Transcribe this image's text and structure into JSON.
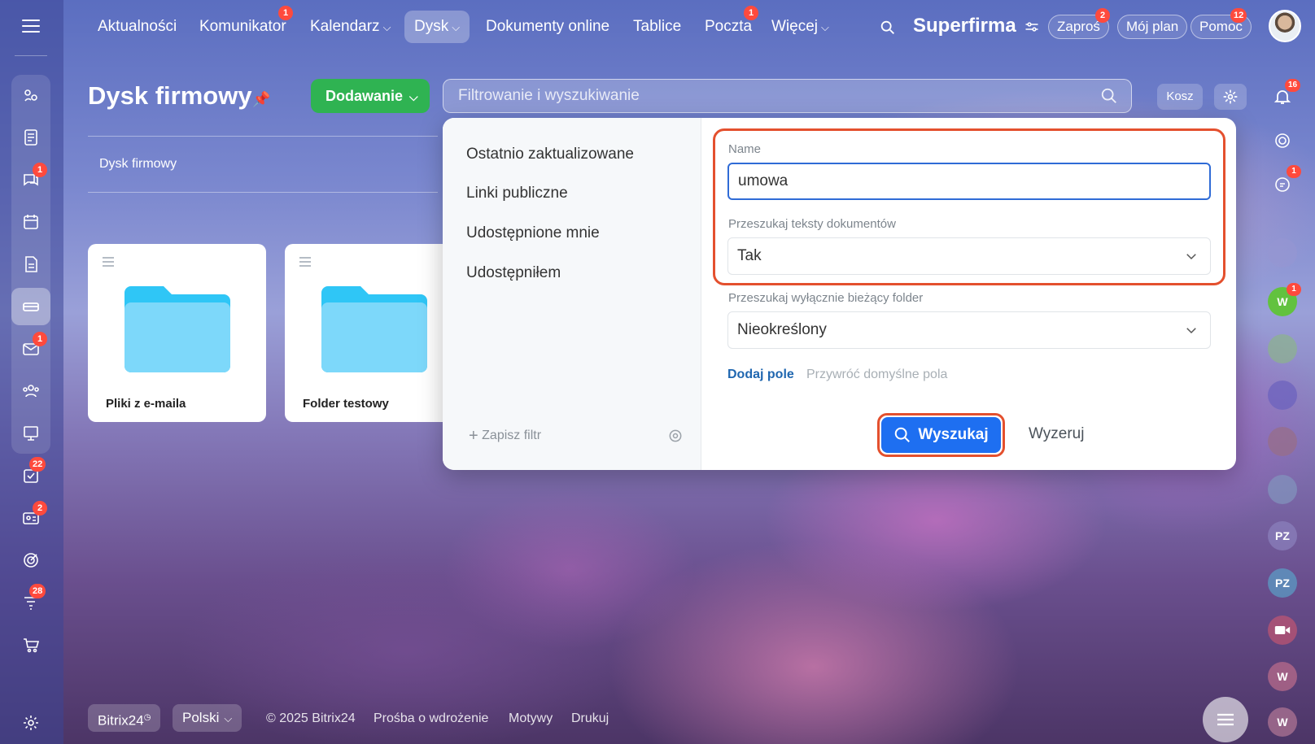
{
  "nav": {
    "items": [
      "Aktualności",
      "Komunikator",
      "Kalendarz",
      "Dysk",
      "Dokumenty online",
      "Tablice",
      "Poczta",
      "Więcej"
    ],
    "badges": {
      "komunikator": "1",
      "poczta": "1"
    },
    "brand": "Superfirma",
    "invite": "Zaproś",
    "invite_badge": "2",
    "my_plan": "Mój plan",
    "help": "Pomoc",
    "help_badge": "12"
  },
  "left_badges": {
    "chat": "1",
    "mail": "1",
    "tasks": "22",
    "crm": "2",
    "sites": "28"
  },
  "page": {
    "title": "Dysk firmowy",
    "add_button": "Dodawanie",
    "search_placeholder": "Filtrowanie i wyszukiwanie",
    "trash_button": "Kosz",
    "breadcrumb": "Dysk firmowy",
    "notifications_badge": "16"
  },
  "folders": [
    {
      "name": "Pliki z e-maila"
    },
    {
      "name": "Folder testowy"
    }
  ],
  "filter": {
    "presets": [
      "Ostatnio zaktualizowane",
      "Linki publiczne",
      "Udostępnione mnie",
      "Udostępniłem"
    ],
    "save_filter": "Zapisz filtr",
    "fields": [
      {
        "label": "Name",
        "value": "umowa"
      },
      {
        "label": "Przeszukaj teksty dokumentów",
        "value": "Tak"
      },
      {
        "label": "Przeszukaj wyłącznie bieżący folder",
        "value": "Nieokreślony"
      }
    ],
    "add_field": "Dodaj pole",
    "restore_fields": "Przywróć domyślne pola",
    "search_button": "Wyszukaj",
    "reset_button": "Wyzeruj"
  },
  "right_rail": {
    "chat_badge": "1",
    "w_badge": "1",
    "avatars": [
      "W",
      "PZ",
      "PZ",
      "W",
      "W"
    ]
  },
  "footer": {
    "brand": "Bitrix24",
    "language": "Polski",
    "copyright": "© 2025 Bitrix24",
    "links": [
      "Prośba o wdrożenie",
      "Motywy",
      "Drukuj"
    ]
  },
  "colors": {
    "accent": "#1e6ff1",
    "add_green": "#2fb352",
    "highlight": "#e4502e",
    "badge": "#ff4a3d"
  }
}
